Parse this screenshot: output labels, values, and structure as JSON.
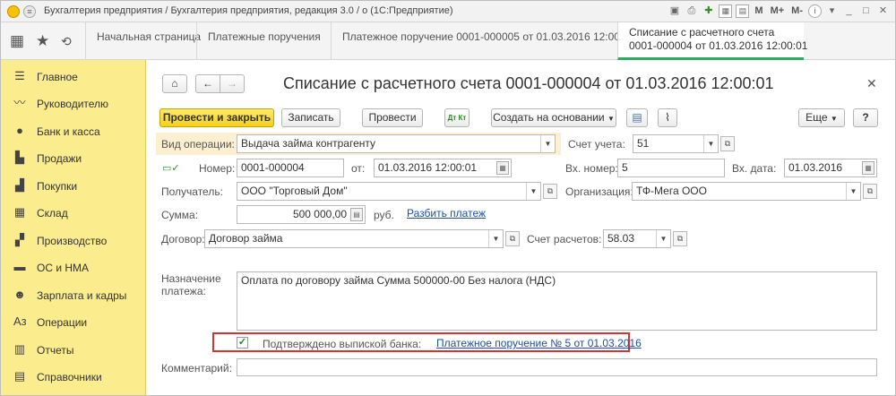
{
  "window": {
    "title": "Бухгалтерия предприятия / Бухгалтерия предприятия, редакция 3.0 / о (1С:Предприятие)",
    "icons": [
      "save-icon",
      "print-icon",
      "favorite-icon",
      "calendar-icon",
      "calc-icon"
    ],
    "m_label": "M",
    "mplus_label": "M+",
    "mminus_label": "M-",
    "info_label": "i"
  },
  "tabs": [
    {
      "label": "Начальная страница"
    },
    {
      "label": "Платежные поручения"
    },
    {
      "label": "Платежное поручение 0001-000005 от 01.03.2016 12:00:00"
    },
    {
      "label_line1": "Списание с расчетного счета",
      "label_line2": "0001-000004 от 01.03.2016 12:00:01",
      "active": true
    }
  ],
  "sidebar": {
    "items": [
      {
        "label": "Главное",
        "icon": "menu-icon"
      },
      {
        "label": "Руководителю",
        "icon": "chart-icon"
      },
      {
        "label": "Банк и касса",
        "icon": "coin-icon"
      },
      {
        "label": "Продажи",
        "icon": "cart-icon"
      },
      {
        "label": "Покупки",
        "icon": "basket-icon"
      },
      {
        "label": "Склад",
        "icon": "warehouse-icon"
      },
      {
        "label": "Производство",
        "icon": "factory-icon"
      },
      {
        "label": "ОС и НМА",
        "icon": "truck-icon"
      },
      {
        "label": "Зарплата и кадры",
        "icon": "people-icon"
      },
      {
        "label": "Операции",
        "icon": "operations-icon"
      },
      {
        "label": "Отчеты",
        "icon": "report-icon"
      },
      {
        "label": "Справочники",
        "icon": "book-icon"
      }
    ]
  },
  "doc": {
    "title": "Списание с расчетного счета 0001-000004 от 01.03.2016 12:00:01",
    "toolbar": {
      "post_close": "Провести и закрыть",
      "save": "Записать",
      "post": "Провести",
      "create_based": "Создать на основании",
      "more": "Еще",
      "help": "?"
    },
    "operation_label": "Вид операции:",
    "operation_value": "Выдача займа контрагенту",
    "account_label": "Счет учета:",
    "account_value": "51",
    "number_label": "Номер:",
    "number_value": "0001-000004",
    "date_label": "от:",
    "date_value": "01.03.2016 12:00:01",
    "in_number_label": "Вх. номер:",
    "in_number_value": "5",
    "in_date_label": "Вх. дата:",
    "in_date_value": "01.03.2016",
    "recipient_label": "Получатель:",
    "recipient_value": "ООО \"Торговый Дом\"",
    "org_label": "Организация:",
    "org_value": "ТФ-Мега ООО",
    "sum_label": "Сумма:",
    "sum_value": "500 000,00",
    "currency": "руб.",
    "split_link": "Разбить платеж",
    "contract_label": "Договор:",
    "contract_value": "Договор займа",
    "settle_label": "Счет расчетов:",
    "settle_value": "58.03",
    "purpose_label_line1": "Назначение",
    "purpose_label_line2": "платежа:",
    "purpose_value": "Оплата по договору займа Сумма 500000-00 Без налога (НДС)",
    "confirmed_checked": true,
    "confirmed_label": "Подтверждено выпиской банка:",
    "confirmed_link": "Платежное поручение № 5 от 01.03.2016",
    "comment_label": "Комментарий:",
    "comment_value": ""
  }
}
